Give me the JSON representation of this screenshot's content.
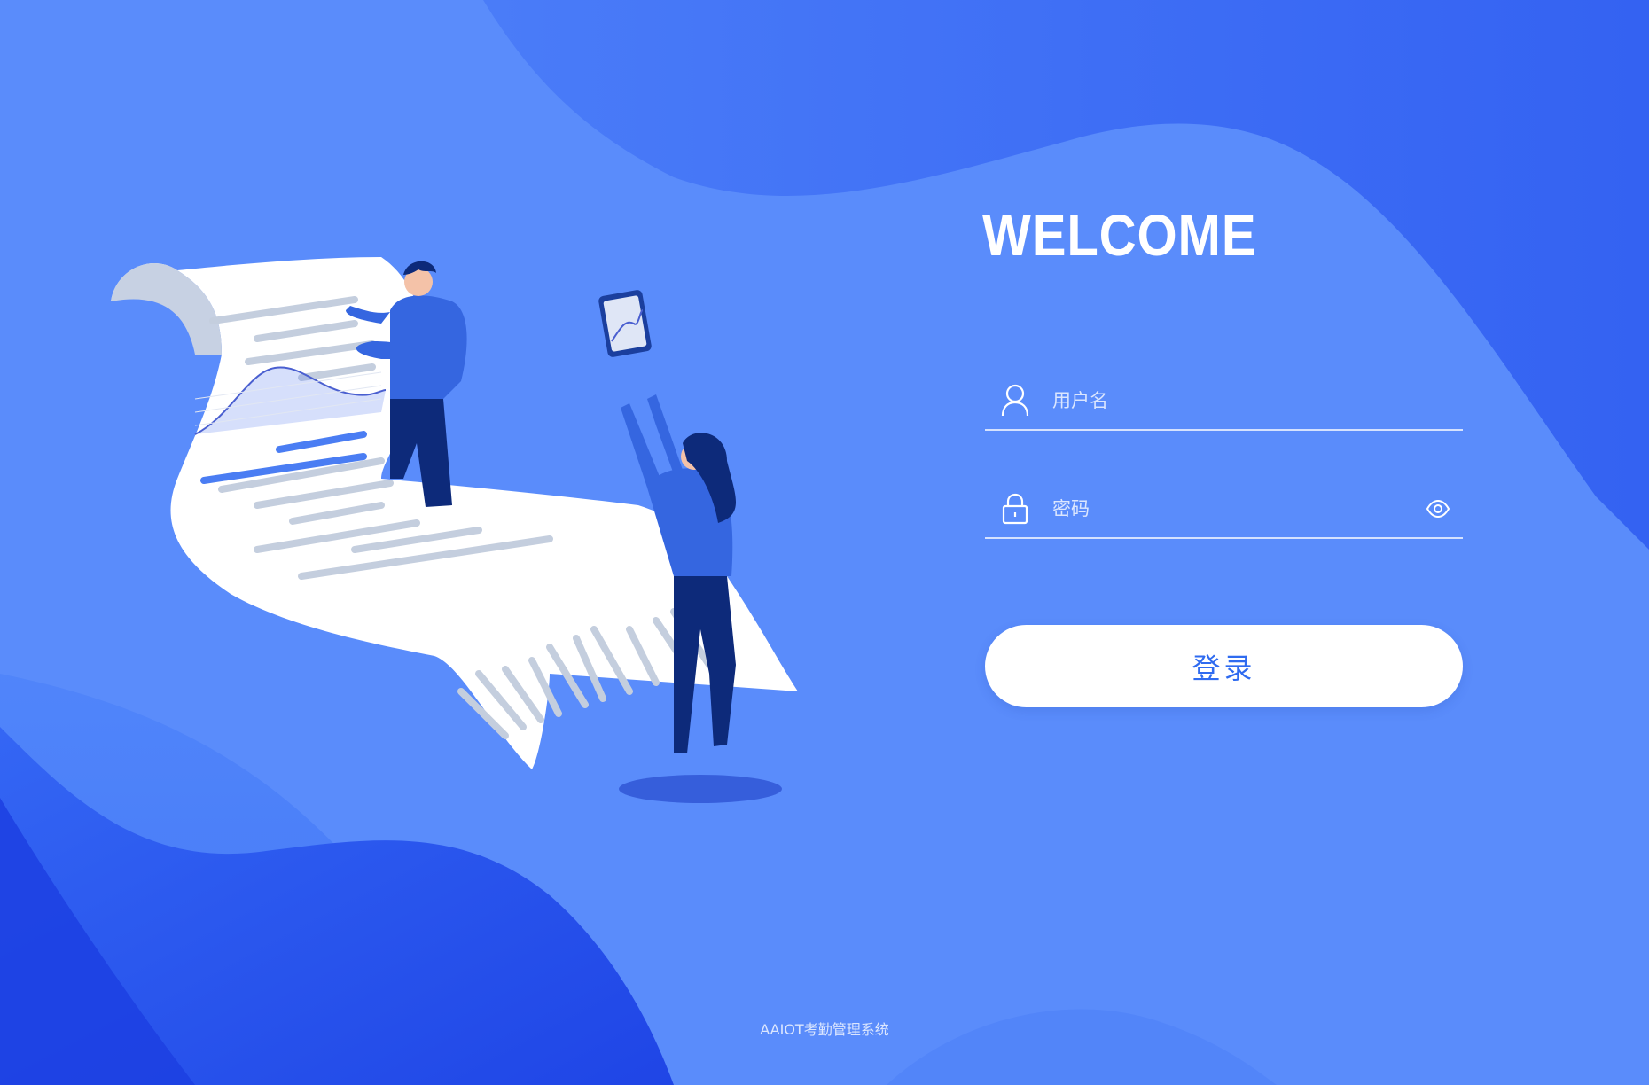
{
  "welcome": "WELCOME",
  "username": {
    "placeholder": "用户名",
    "icon": "user-icon"
  },
  "password": {
    "placeholder": "密码",
    "icon": "lock-icon",
    "toggle_icon": "eye-icon"
  },
  "login_button": "登录",
  "footer": "AAIOT考勤管理系统",
  "colors": {
    "background": "#5a8cfb",
    "button_bg": "#ffffff",
    "button_text": "#2f6bf0"
  }
}
